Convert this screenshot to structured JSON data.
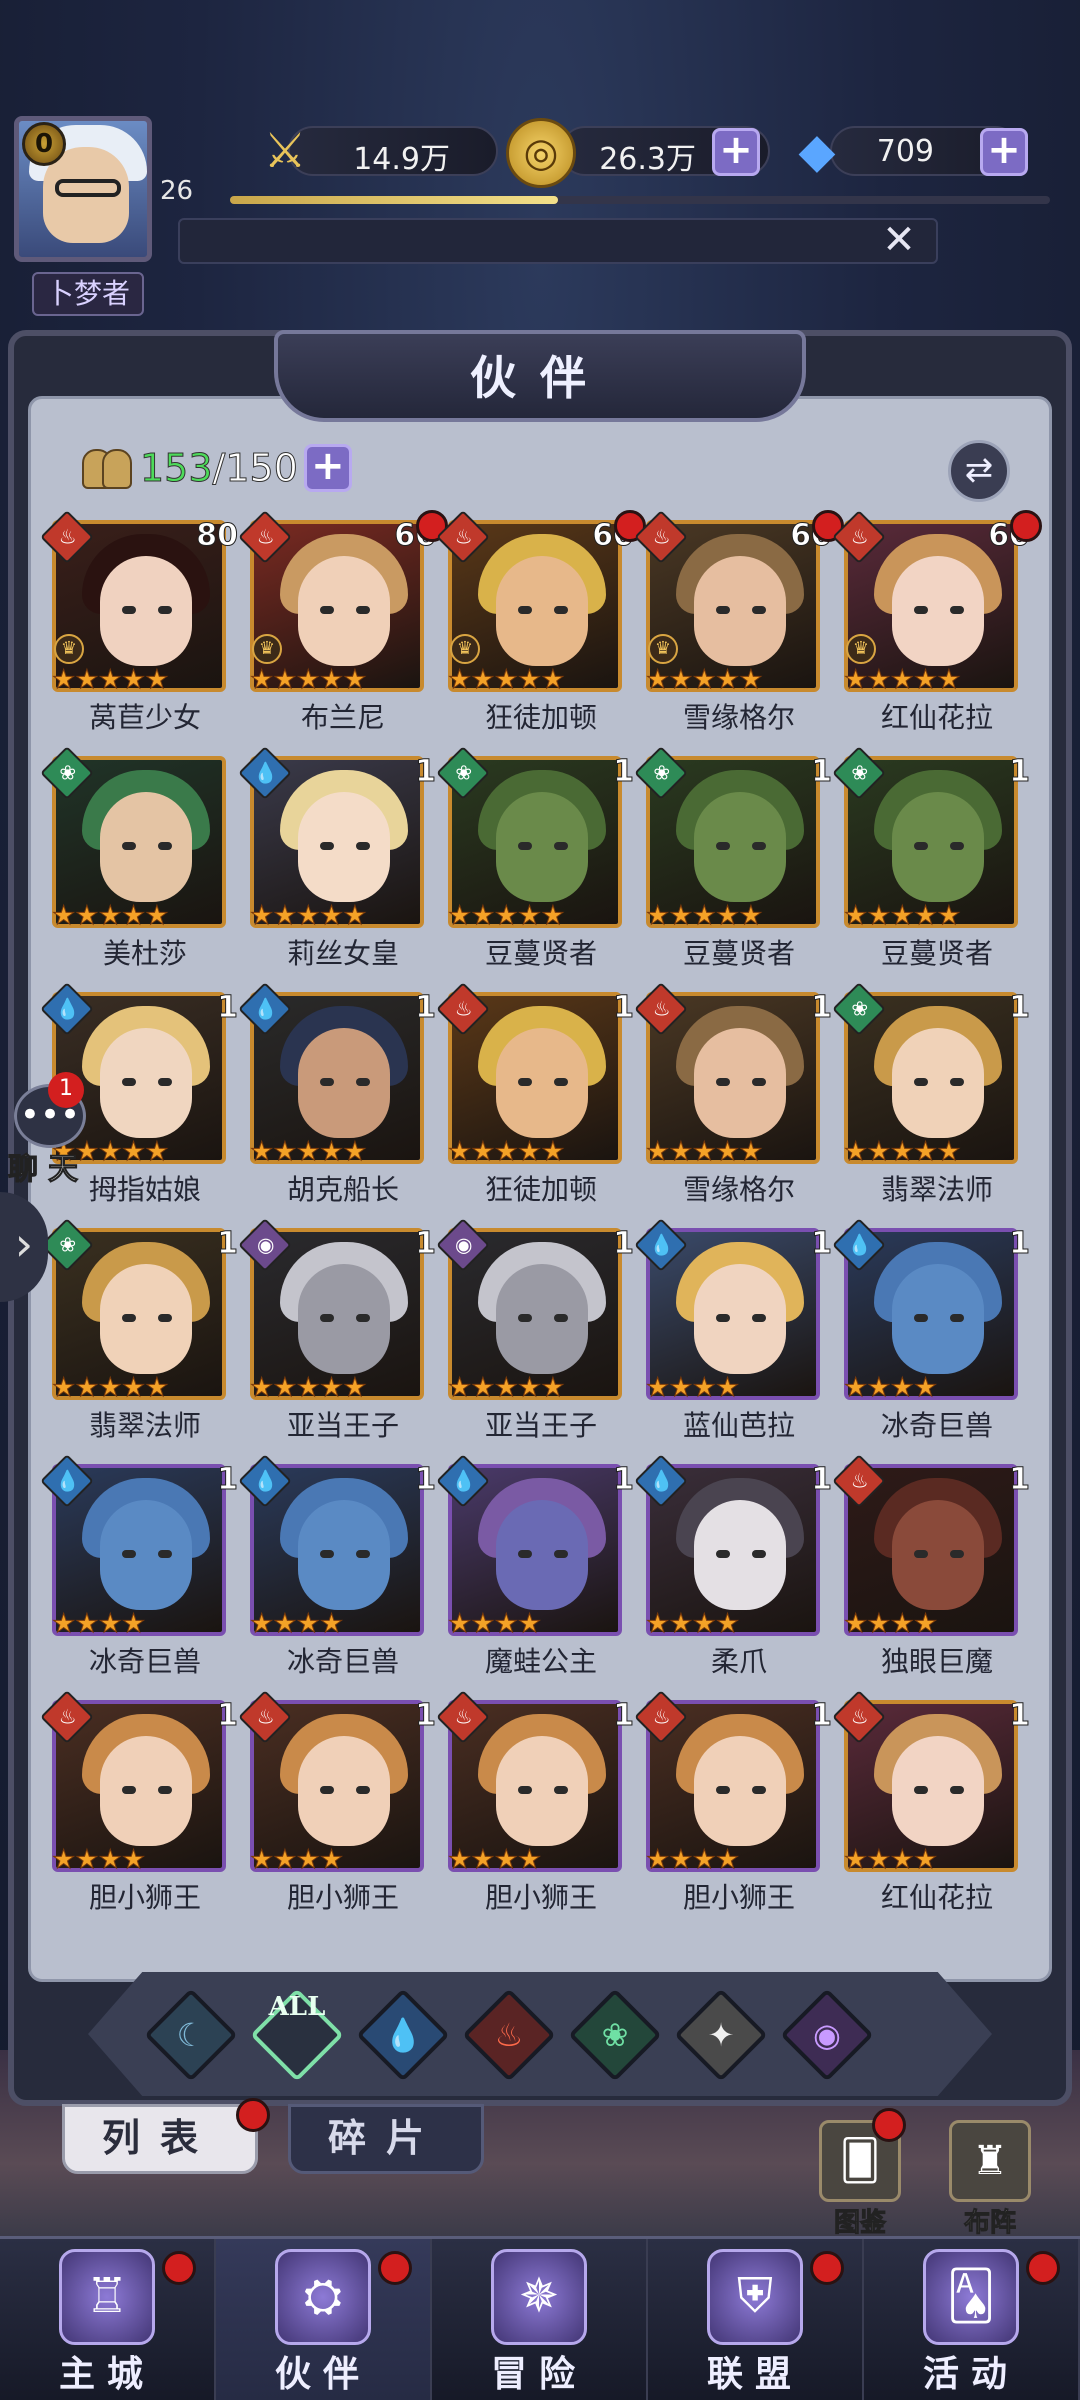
{
  "player": {
    "vip": "0",
    "level": "26",
    "rank": "卜梦者",
    "xp_fraction": 0.4
  },
  "resources": [
    {
      "name": "power",
      "icon": "winged-sword-icon",
      "value": "14.9万"
    },
    {
      "name": "gold",
      "icon": "gold-coin-icon",
      "value": "26.3万"
    },
    {
      "name": "diamond",
      "icon": "diamond-icon",
      "value": "709"
    }
  ],
  "panel": {
    "title": "伙伴",
    "count_current": "153",
    "count_max": "/150"
  },
  "heroes": [
    {
      "name": "莴苣少女",
      "level": "80",
      "stars": 5,
      "element": "fire",
      "frame": "gold",
      "red": false,
      "crown": true,
      "colors": [
        "#3a1f1a",
        "#f0d2c0",
        "#2a1210"
      ]
    },
    {
      "name": "布兰尼",
      "level": "66",
      "stars": 5,
      "element": "fire",
      "frame": "gold",
      "red": true,
      "crown": true,
      "colors": [
        "#7a2a22",
        "#f0d0b8",
        "#c99a62"
      ]
    },
    {
      "name": "狂徒加顿",
      "level": "60",
      "stars": 5,
      "element": "fire",
      "frame": "gold",
      "red": true,
      "crown": true,
      "colors": [
        "#5a3818",
        "#e7b88a",
        "#d9b24a"
      ]
    },
    {
      "name": "雪缘格尔",
      "level": "60",
      "stars": 5,
      "element": "fire",
      "frame": "gold",
      "red": true,
      "crown": true,
      "colors": [
        "#4a3824",
        "#e6bea0",
        "#8a6a44"
      ]
    },
    {
      "name": "红仙花拉",
      "level": "60",
      "stars": 5,
      "element": "fire",
      "frame": "gold",
      "red": true,
      "crown": true,
      "colors": [
        "#5a2a3a",
        "#f2d4c4",
        "#c9955a"
      ]
    },
    {
      "name": "美杜莎",
      "level": "",
      "stars": 5,
      "element": "wind",
      "frame": "gold",
      "red": false,
      "crown": false,
      "colors": [
        "#203428",
        "#e4c4a4",
        "#3a7a4a"
      ]
    },
    {
      "name": "莉丝女皇",
      "level": "1",
      "stars": 5,
      "element": "water",
      "frame": "gold",
      "red": false,
      "crown": false,
      "colors": [
        "#3a3a4a",
        "#f4dcc8",
        "#e8d49a"
      ]
    },
    {
      "name": "豆蔓贤者",
      "level": "1",
      "stars": 5,
      "element": "wind",
      "frame": "gold",
      "red": false,
      "crown": false,
      "colors": [
        "#2a3a20",
        "#6a8a4a",
        "#4a6a34"
      ]
    },
    {
      "name": "豆蔓贤者",
      "level": "1",
      "stars": 5,
      "element": "wind",
      "frame": "gold",
      "red": false,
      "crown": false,
      "colors": [
        "#2a3a20",
        "#6a8a4a",
        "#4a6a34"
      ]
    },
    {
      "name": "豆蔓贤者",
      "level": "1",
      "stars": 5,
      "element": "wind",
      "frame": "gold",
      "red": false,
      "crown": false,
      "colors": [
        "#2a3a20",
        "#6a8a4a",
        "#4a6a34"
      ]
    },
    {
      "name": "拇指姑娘",
      "level": "1",
      "stars": 5,
      "element": "water",
      "frame": "gold",
      "red": false,
      "crown": false,
      "colors": [
        "#3a2e24",
        "#f0d6c0",
        "#e4c27a"
      ]
    },
    {
      "name": "胡克船长",
      "level": "1",
      "stars": 5,
      "element": "water",
      "frame": "gold",
      "red": false,
      "crown": false,
      "colors": [
        "#2a2a2a",
        "#c99a7a",
        "#2a3450"
      ]
    },
    {
      "name": "狂徒加顿",
      "level": "1",
      "stars": 5,
      "element": "fire",
      "frame": "gold",
      "red": false,
      "crown": false,
      "colors": [
        "#5a3818",
        "#e7b88a",
        "#d9b24a"
      ]
    },
    {
      "name": "雪缘格尔",
      "level": "1",
      "stars": 5,
      "element": "fire",
      "frame": "gold",
      "red": false,
      "crown": false,
      "colors": [
        "#4a3824",
        "#e6bea0",
        "#8a6a44"
      ]
    },
    {
      "name": "翡翠法师",
      "level": "1",
      "stars": 5,
      "element": "wind",
      "frame": "gold",
      "red": false,
      "crown": false,
      "colors": [
        "#3a3020",
        "#f0d2b8",
        "#c99a4a"
      ]
    },
    {
      "name": "翡翠法师",
      "level": "1",
      "stars": 5,
      "element": "wind",
      "frame": "gold",
      "red": false,
      "crown": false,
      "colors": [
        "#3a3020",
        "#f0d2b8",
        "#c99a4a"
      ]
    },
    {
      "name": "亚当王子",
      "level": "1",
      "stars": 5,
      "element": "void",
      "frame": "gold",
      "red": false,
      "crown": false,
      "colors": [
        "#2a2a2e",
        "#9a9aa4",
        "#c4c4cc"
      ]
    },
    {
      "name": "亚当王子",
      "level": "1",
      "stars": 5,
      "element": "void",
      "frame": "gold",
      "red": false,
      "crown": false,
      "colors": [
        "#2a2a2e",
        "#9a9aa4",
        "#c4c4cc"
      ]
    },
    {
      "name": "蓝仙芭拉",
      "level": "1",
      "stars": 4,
      "element": "water",
      "frame": "purple",
      "red": false,
      "crown": false,
      "colors": [
        "#3a4a6a",
        "#f0d4c0",
        "#e0b45a"
      ]
    },
    {
      "name": "冰奇巨兽",
      "level": "1",
      "stars": 4,
      "element": "water",
      "frame": "purple",
      "red": false,
      "crown": false,
      "colors": [
        "#2a3a5a",
        "#5a8ac4",
        "#4a78b4"
      ]
    },
    {
      "name": "冰奇巨兽",
      "level": "1",
      "stars": 4,
      "element": "water",
      "frame": "purple",
      "red": false,
      "crown": false,
      "colors": [
        "#2a3a5a",
        "#5a8ac4",
        "#4a78b4"
      ]
    },
    {
      "name": "冰奇巨兽",
      "level": "1",
      "stars": 4,
      "element": "water",
      "frame": "purple",
      "red": false,
      "crown": false,
      "colors": [
        "#2a3a5a",
        "#5a8ac4",
        "#4a78b4"
      ]
    },
    {
      "name": "魔蛙公主",
      "level": "1",
      "stars": 4,
      "element": "water",
      "frame": "purple",
      "red": false,
      "crown": false,
      "colors": [
        "#4a3a6a",
        "#6a6ab4",
        "#7a5aa4"
      ]
    },
    {
      "name": "柔爪",
      "level": "1",
      "stars": 4,
      "element": "water",
      "frame": "purple",
      "red": false,
      "crown": false,
      "colors": [
        "#3a2e3a",
        "#e4e0e4",
        "#4a4450"
      ]
    },
    {
      "name": "独眼巨魔",
      "level": "1",
      "stars": 4,
      "element": "fire",
      "frame": "purple",
      "red": false,
      "crown": false,
      "colors": [
        "#2e1a18",
        "#8a4a3a",
        "#5a2a22"
      ]
    },
    {
      "name": "胆小狮王",
      "level": "1",
      "stars": 4,
      "element": "fire",
      "frame": "purple",
      "red": false,
      "crown": false,
      "colors": [
        "#4a2e22",
        "#f0d0b8",
        "#c98a4a"
      ]
    },
    {
      "name": "胆小狮王",
      "level": "1",
      "stars": 4,
      "element": "fire",
      "frame": "purple",
      "red": false,
      "crown": false,
      "colors": [
        "#4a2e22",
        "#f0d0b8",
        "#c98a4a"
      ]
    },
    {
      "name": "胆小狮王",
      "level": "1",
      "stars": 4,
      "element": "fire",
      "frame": "purple",
      "red": false,
      "crown": false,
      "colors": [
        "#4a2e22",
        "#f0d0b8",
        "#c98a4a"
      ]
    },
    {
      "name": "胆小狮王",
      "level": "1",
      "stars": 4,
      "element": "fire",
      "frame": "purple",
      "red": false,
      "crown": false,
      "colors": [
        "#4a2e22",
        "#f0d0b8",
        "#c98a4a"
      ]
    },
    {
      "name": "红仙花拉",
      "level": "1",
      "stars": 4,
      "element": "fire",
      "frame": "gold",
      "red": false,
      "crown": false,
      "colors": [
        "#5a2a3a",
        "#f2d4c4",
        "#c9955a"
      ]
    }
  ],
  "filters": [
    {
      "id": "sky",
      "icon": "crescent-element-icon",
      "label": ""
    },
    {
      "id": "all",
      "icon": "all-filter-icon",
      "label": "ALL"
    },
    {
      "id": "water",
      "icon": "water-drop-icon",
      "label": ""
    },
    {
      "id": "fire",
      "icon": "flame-icon",
      "label": ""
    },
    {
      "id": "wind",
      "icon": "wind-swirl-icon",
      "label": ""
    },
    {
      "id": "light",
      "icon": "star-burst-icon",
      "label": ""
    },
    {
      "id": "void",
      "icon": "eye-void-icon",
      "label": ""
    }
  ],
  "tabs": {
    "list": "列表",
    "fragments": "碎片"
  },
  "side": {
    "codex": "图鉴",
    "formation": "布阵"
  },
  "chat": {
    "label": "聊天",
    "unread": "1"
  },
  "nav": [
    {
      "label": "主城",
      "icon": "castle-icon",
      "active": false,
      "red": true
    },
    {
      "label": "伙伴",
      "icon": "wizard-hat-icon",
      "active": true,
      "red": true
    },
    {
      "label": "冒险",
      "icon": "compass-portal-icon",
      "active": false,
      "red": false
    },
    {
      "label": "联盟",
      "icon": "shield-emblem-icon",
      "active": false,
      "red": true
    },
    {
      "label": "活动",
      "icon": "cards-icon",
      "active": false,
      "red": true
    }
  ],
  "colors": {
    "fire": "#c0392b",
    "water": "#2f6fb0",
    "wind": "#2e8b57",
    "void": "#6c4a8c",
    "gold_frame": "#c88a2e",
    "purple_frame": "#7a4fb0"
  }
}
